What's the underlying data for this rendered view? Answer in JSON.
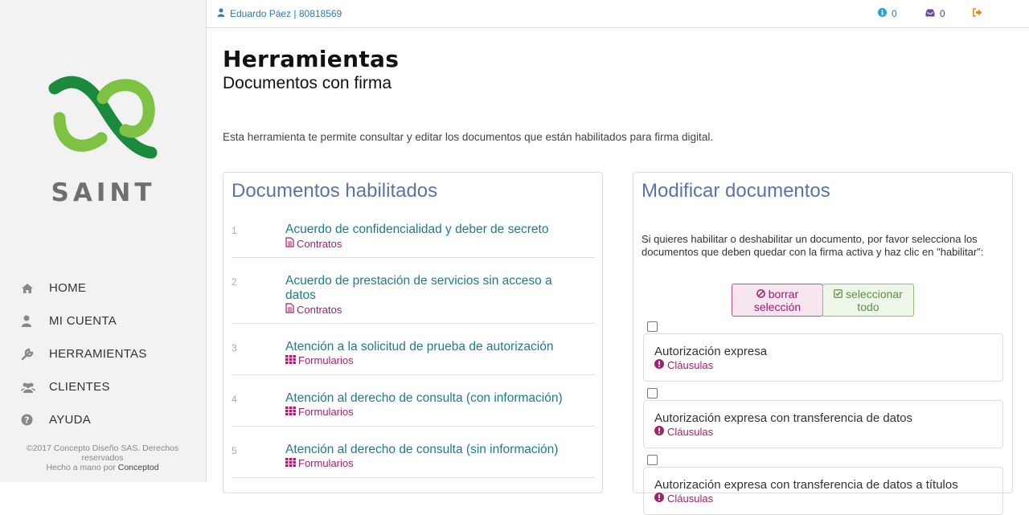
{
  "app": {
    "logo_text": "SAINT",
    "colors": {
      "accent_blue": "#2a7ab8",
      "green": "#7dc242",
      "dark_green": "#1a8a3c",
      "magenta": "#a0226b",
      "teal": "#217b86",
      "title_blue": "#5a74a8"
    }
  },
  "topbar": {
    "user": "Eduardo Páez | 80818569",
    "info_count": "0",
    "inbox_count": "0"
  },
  "sidebar": {
    "items": [
      {
        "label": "HOME",
        "icon": "home-icon"
      },
      {
        "label": "MI CUENTA",
        "icon": "user-icon"
      },
      {
        "label": "HERRAMIENTAS",
        "icon": "wrench-icon"
      },
      {
        "label": "CLIENTES",
        "icon": "users-icon"
      },
      {
        "label": "AYUDA",
        "icon": "question-icon"
      }
    ],
    "footer_line1": "©2017 Concepto Diseño SAS. Derechos reservados",
    "footer_line2_prefix": "Hecho a mano por ",
    "footer_brand": "Conceptod"
  },
  "page": {
    "title": "Herramientas",
    "subtitle": "Documentos con firma",
    "intro": "Esta herramienta te permite consultar y editar los documentos que están habilitados para firma digital."
  },
  "left_panel": {
    "title": "Documentos habilitados",
    "docs": [
      {
        "num": "1",
        "title": "Acuerdo de confidencialidad y deber de secreto",
        "category": "Contratos",
        "icon": "document-icon"
      },
      {
        "num": "2",
        "title": "Acuerdo de prestación de servicios sin acceso a datos",
        "category": "Contratos",
        "icon": "document-icon"
      },
      {
        "num": "3",
        "title": "Atención a la solicitud de prueba de autorización",
        "category": "Formularios",
        "icon": "grid-icon"
      },
      {
        "num": "4",
        "title": "Atención al derecho de consulta (con información)",
        "category": "Formularios",
        "icon": "grid-icon"
      },
      {
        "num": "5",
        "title": "Atención al derecho de consulta (sin información)",
        "category": "Formularios",
        "icon": "grid-icon"
      }
    ]
  },
  "right_panel": {
    "title": "Modificar documentos",
    "instructions": "Si quieres habilitar o deshabilitar un documento, por favor selecciona los documentos que deben quedar con la firma activa y haz clic en \"habilitar\":",
    "clear_button": "borrar selección",
    "select_all_button": "seleccionar todo",
    "items": [
      {
        "title": "Autorización expresa",
        "category": "Cláusulas",
        "checked": false
      },
      {
        "title": "Autorización expresa con transferencia de datos",
        "category": "Cláusulas",
        "checked": false
      },
      {
        "title": "Autorización expresa con transferencia de datos a títulos",
        "category": "Cláusulas",
        "checked": false
      }
    ]
  }
}
